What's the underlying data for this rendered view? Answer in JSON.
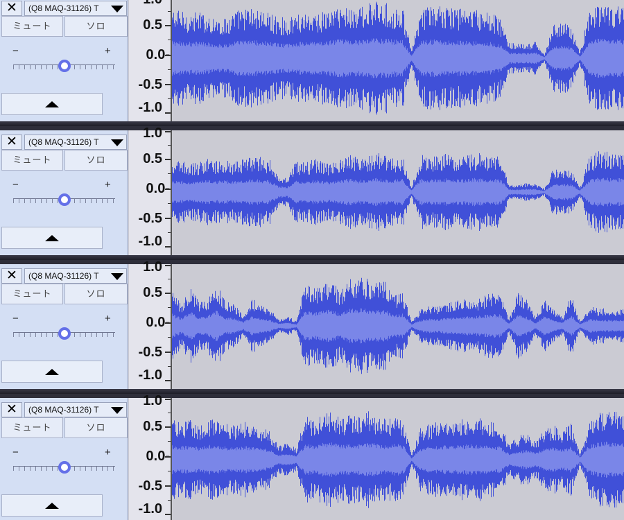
{
  "track_list": [
    {
      "name": "(Q8 MAQ-31126) T",
      "mute_label": "ミュート",
      "solo_label": "ソロ",
      "gain_minus": "−",
      "gain_plus": "+",
      "gain_level": 0.5,
      "scale": [
        "1.0",
        "0.5",
        "0.0-",
        "-0.5",
        "-1.0"
      ],
      "waveform_profile": [
        0.86,
        0.84,
        0.8,
        0.82,
        0.78,
        0.72,
        0.7,
        0.84,
        0.88,
        0.9,
        0.86,
        0.8,
        0.74,
        0.7,
        0.78,
        0.84,
        0.8,
        0.82,
        0.88,
        0.94,
        0.92,
        0.9,
        0.96,
        1.0,
        0.98,
        0.92,
        0.9,
        0.12,
        0.86,
        0.92,
        0.94,
        0.9,
        0.88,
        0.9,
        0.86,
        0.82,
        0.8,
        0.7,
        0.28,
        0.26,
        0.24,
        0.3,
        0.06,
        0.6,
        0.64,
        0.58,
        0.1,
        0.84,
        0.96,
        0.94,
        0.92,
        0.96
      ]
    },
    {
      "name": "(Q8 MAQ-31126) T",
      "mute_label": "ミュート",
      "solo_label": "ソロ",
      "gain_minus": "−",
      "gain_plus": "+",
      "gain_level": 0.5,
      "scale": [
        "1.0",
        "0.5",
        "0.0-",
        "-0.5",
        "-1.0"
      ],
      "waveform_profile": [
        0.52,
        0.56,
        0.5,
        0.54,
        0.6,
        0.56,
        0.58,
        0.54,
        0.6,
        0.64,
        0.62,
        0.58,
        0.3,
        0.26,
        0.56,
        0.52,
        0.6,
        0.56,
        0.5,
        0.62,
        0.66,
        0.6,
        0.64,
        0.7,
        0.66,
        0.62,
        0.64,
        0.1,
        0.66,
        0.62,
        0.64,
        0.7,
        0.66,
        0.64,
        0.7,
        0.68,
        0.64,
        0.66,
        0.14,
        0.12,
        0.16,
        0.14,
        0.06,
        0.42,
        0.4,
        0.4,
        0.08,
        0.6,
        0.74,
        0.72,
        0.68,
        0.7
      ]
    },
    {
      "name": "(Q8 MAQ-31126) T",
      "mute_label": "ミュート",
      "solo_label": "ソロ",
      "gain_minus": "−",
      "gain_plus": "+",
      "gain_level": 0.5,
      "scale": [
        "1.0",
        "0.5",
        "0.0-",
        "-0.5",
        "-1.0"
      ],
      "waveform_profile": [
        0.6,
        0.4,
        0.72,
        0.44,
        0.5,
        0.78,
        0.42,
        0.4,
        0.2,
        0.48,
        0.4,
        0.3,
        0.12,
        0.18,
        0.08,
        0.78,
        0.66,
        0.74,
        0.82,
        0.6,
        0.86,
        0.88,
        0.84,
        0.76,
        0.8,
        0.54,
        0.6,
        0.08,
        0.3,
        0.36,
        0.34,
        0.4,
        0.44,
        0.48,
        0.46,
        0.52,
        0.6,
        0.56,
        0.12,
        0.58,
        0.46,
        0.14,
        0.5,
        0.3,
        0.16,
        0.56,
        0.08,
        0.34,
        0.32,
        0.3,
        0.28,
        0.32
      ]
    },
    {
      "name": "(Q8 MAQ-31126) T",
      "mute_label": "ミュート",
      "solo_label": "ソロ",
      "gain_minus": "−",
      "gain_plus": "+",
      "gain_level": 0.5,
      "scale": [
        "1.0",
        "0.5",
        "0.0-",
        "-0.5",
        "-1.0"
      ],
      "waveform_profile": [
        0.72,
        0.66,
        0.7,
        0.62,
        0.74,
        0.7,
        0.66,
        0.6,
        0.68,
        0.62,
        0.58,
        0.5,
        0.24,
        0.3,
        0.2,
        0.78,
        0.7,
        0.82,
        0.88,
        0.74,
        0.8,
        0.76,
        0.86,
        0.8,
        0.72,
        0.78,
        0.76,
        0.08,
        0.58,
        0.64,
        0.68,
        0.72,
        0.7,
        0.74,
        0.76,
        0.72,
        0.7,
        0.64,
        0.3,
        0.4,
        0.5,
        0.34,
        0.56,
        0.62,
        0.5,
        0.66,
        0.1,
        0.7,
        0.84,
        0.9,
        0.86,
        0.82
      ]
    }
  ],
  "colors": {
    "waveform_peak": "#4050d8",
    "waveform_rms": "#7a86e8",
    "waveform_bg": "#cbcbd3"
  },
  "icons": {
    "close": "close-icon",
    "menu": "dropdown-arrow-icon",
    "collapse": "collapse-up-icon"
  }
}
